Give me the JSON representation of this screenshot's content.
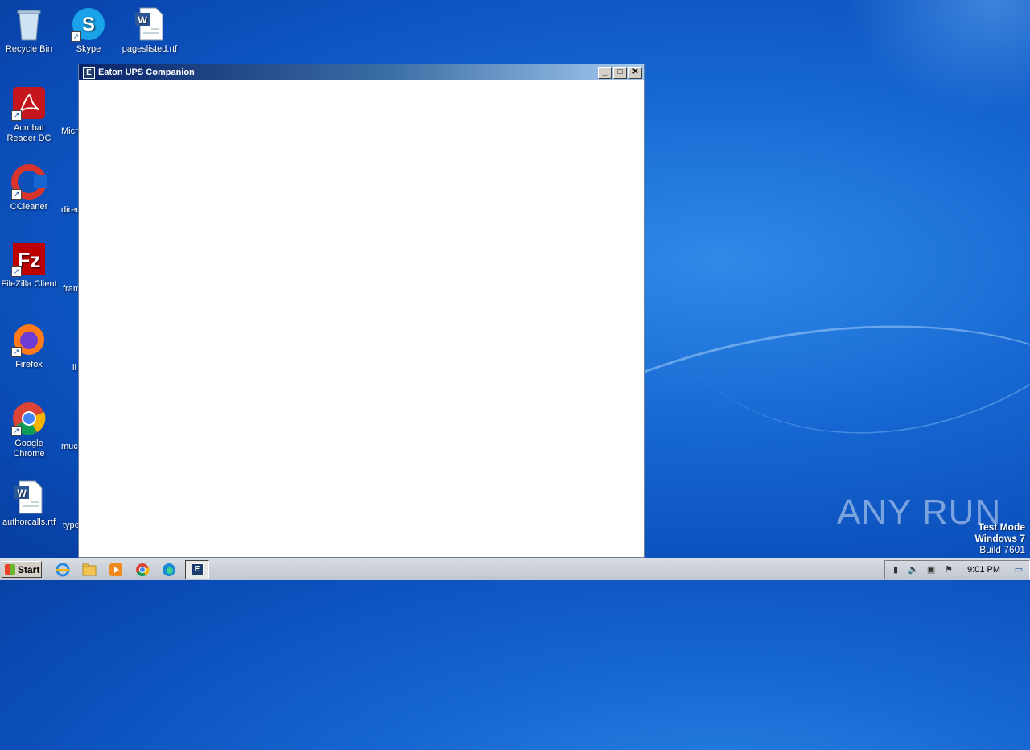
{
  "desktop": {
    "icons": [
      {
        "label": "Recycle Bin",
        "name": "recycle-bin-icon"
      },
      {
        "label": "Skype",
        "name": "skype-icon"
      },
      {
        "label": "pageslisted.rtf",
        "name": "word-document-icon"
      },
      {
        "label": "Acrobat Reader DC",
        "name": "acrobat-reader-icon"
      },
      {
        "label": "CCleaner",
        "name": "ccleaner-icon"
      },
      {
        "label": "FileZilla Client",
        "name": "filezilla-icon"
      },
      {
        "label": "Firefox",
        "name": "firefox-icon"
      },
      {
        "label": "Google Chrome",
        "name": "chrome-icon"
      },
      {
        "label": "authorcalls.rtf",
        "name": "word-document-icon"
      }
    ],
    "partial_labels": [
      "Micro",
      "direc",
      "fram",
      "li",
      "much",
      "type"
    ]
  },
  "window": {
    "title": "Eaton UPS Companion",
    "icon_letter": "E",
    "minimize_glyph": "_",
    "maximize_glyph": "□",
    "close_glyph": "✕"
  },
  "watermark": {
    "brand": "ANY RUN",
    "test_mode": "Test Mode",
    "os": "Windows 7",
    "build": "Build 7601"
  },
  "taskbar": {
    "start_label": "Start",
    "pinned": [
      "internet-explorer-icon",
      "file-explorer-icon",
      "media-player-icon",
      "chrome-icon",
      "edge-icon"
    ],
    "active_app_letter": "E",
    "clock": "9:01 PM"
  }
}
